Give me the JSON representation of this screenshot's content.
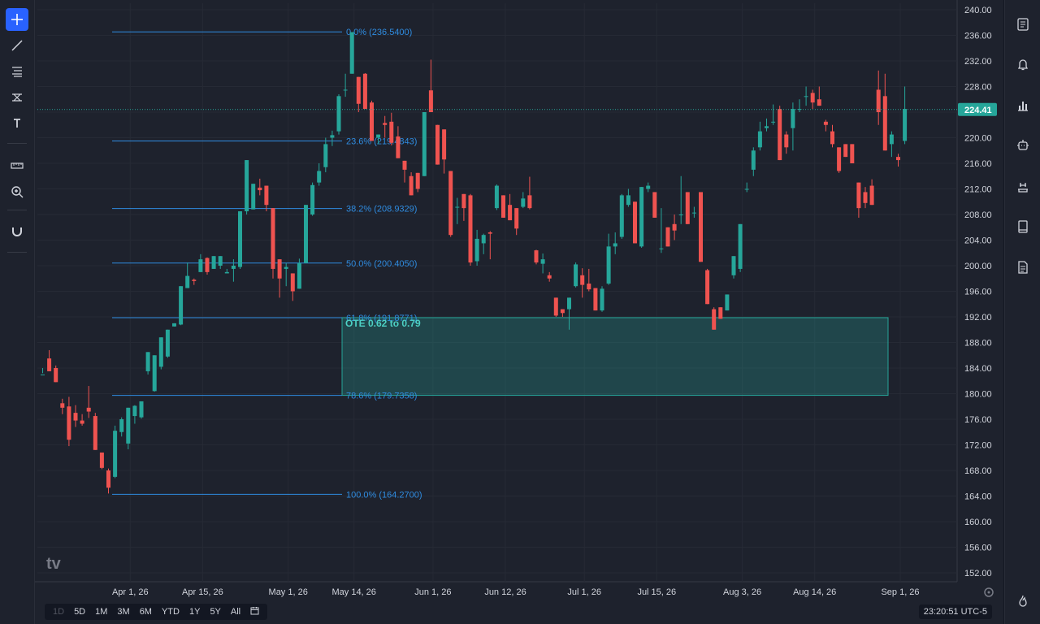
{
  "toolbar": {
    "tools": [
      {
        "name": "crosshair-tool",
        "icon": "crosshair-icon",
        "active": true
      },
      {
        "name": "trend-line-tool",
        "icon": "trend-line-icon"
      },
      {
        "name": "fib-retracement-tool",
        "icon": "fib-retracement-icon"
      },
      {
        "name": "patterns-tool",
        "icon": "patterns-icon"
      },
      {
        "name": "text-tool",
        "icon": "text-icon",
        "label": "T"
      },
      {
        "name": "ruler-tool",
        "icon": "ruler-icon"
      },
      {
        "name": "zoom-tool",
        "icon": "zoom-in-icon"
      },
      {
        "name": "magnet-tool",
        "icon": "magnet-icon"
      }
    ]
  },
  "right_panel": {
    "tools": [
      {
        "name": "watchlist-button",
        "icon": "document-list-icon"
      },
      {
        "name": "alerts-button",
        "icon": "bell-icon"
      },
      {
        "name": "data-window-button",
        "icon": "bar-chart-icon"
      },
      {
        "name": "hotlist-button",
        "icon": "robot-icon"
      },
      {
        "name": "calendar-button",
        "icon": "calendar-icon"
      },
      {
        "name": "notes-button",
        "icon": "book-icon"
      },
      {
        "name": "news-button",
        "icon": "news-icon"
      },
      {
        "name": "help-button",
        "icon": "flame-icon"
      }
    ]
  },
  "chart_data": {
    "type": "candlestick",
    "y_ticks": [
      "240.00",
      "236.00",
      "232.00",
      "228.00",
      "224.00",
      "220.00",
      "216.00",
      "212.00",
      "208.00",
      "204.00",
      "200.00",
      "196.00",
      "192.00",
      "188.00",
      "184.00",
      "180.00",
      "176.00",
      "172.00",
      "168.00",
      "164.00",
      "160.00",
      "156.00",
      "152.00"
    ],
    "y_range": [
      150.5,
      241.5
    ],
    "x_ticks": [
      "Apr 1, 26",
      "Apr 15, 26",
      "May 1, 26",
      "May 14, 26",
      "Jun 1, 26",
      "Jun 12, 26",
      "Jul 1, 26",
      "Jul 15, 26",
      "Aug 3, 26",
      "Aug 14, 26",
      "Sep 1, 26"
    ],
    "last_price": "224.41",
    "colors": {
      "up": "#26a69a",
      "down": "#ef5350",
      "fib": "#2f8ce0",
      "ote_fill": "#26a69a",
      "background": "#1e222d",
      "grid": "#2a2e39"
    },
    "fibonacci": {
      "levels": [
        {
          "label": "0.0% (236.5400)",
          "price": 236.54
        },
        {
          "label": "23.6% (219.4843)",
          "price": 219.4843
        },
        {
          "label": "38.2% (208.9329)",
          "price": 208.9329
        },
        {
          "label": "50.0% (200.4050)",
          "price": 200.405
        },
        {
          "label": "61.8% (191.8771)",
          "price": 191.8771
        },
        {
          "label": "78.6% (179.7358)",
          "price": 179.7358
        },
        {
          "label": "100.0% (164.2700)",
          "price": 164.27
        }
      ]
    },
    "ote_zone": {
      "label": "OTE 0.62 to 0.79",
      "top": 191.8771,
      "bottom": 179.7358
    },
    "candles": [
      [
        183.0,
        183.2,
        184.0,
        183.0
      ],
      [
        185.5,
        186.8,
        183.5,
        183.5
      ],
      [
        184.0,
        184.4,
        181.8,
        181.8
      ],
      [
        178.5,
        179.2,
        176.8,
        177.8
      ],
      [
        178.0,
        179.5,
        171.8,
        172.8
      ],
      [
        177.0,
        178.2,
        174.8,
        175.8
      ],
      [
        175.8,
        176.8,
        175.0,
        175.3
      ],
      [
        177.8,
        181.2,
        176.2,
        177.2
      ],
      [
        176.5,
        177.0,
        171.2,
        171.2
      ],
      [
        170.8,
        170.8,
        168.2,
        168.4
      ],
      [
        168.0,
        168.3,
        164.4,
        165.3
      ],
      [
        167.0,
        175.0,
        166.8,
        174.2
      ],
      [
        174.0,
        176.3,
        173.3,
        176.0
      ],
      [
        172.2,
        177.8,
        171.3,
        177.8
      ],
      [
        176.5,
        178.2,
        175.3,
        178.1
      ],
      [
        176.3,
        178.8,
        176.1,
        178.8
      ],
      [
        183.5,
        186.5,
        183.0,
        186.5
      ],
      [
        180.4,
        186.0,
        180.3,
        186.0
      ],
      [
        184.2,
        188.8,
        183.8,
        188.8
      ],
      [
        185.8,
        190.0,
        185.6,
        190.0
      ],
      [
        190.5,
        191.0,
        190.5,
        191.0
      ],
      [
        190.8,
        196.8,
        190.7,
        196.8
      ],
      [
        196.5,
        200.5,
        196.5,
        198.4
      ],
      [
        197.8,
        198.0,
        197.0,
        197.6
      ],
      [
        199.0,
        201.8,
        199.0,
        201.0
      ],
      [
        201.2,
        201.3,
        198.6,
        199.0
      ],
      [
        199.5,
        201.5,
        199.5,
        201.5
      ],
      [
        200.0,
        201.5,
        199.5,
        201.5
      ],
      [
        198.8,
        199.5,
        198.8,
        199.0
      ],
      [
        199.5,
        201.0,
        197.5,
        200.0
      ],
      [
        199.8,
        208.5,
        199.5,
        208.5
      ],
      [
        208.5,
        216.5,
        208.0,
        216.5
      ],
      [
        208.8,
        212.8,
        208.8,
        212.8
      ],
      [
        212.2,
        213.6,
        211.0,
        211.8
      ],
      [
        212.5,
        212.5,
        208.5,
        209.5
      ],
      [
        209.0,
        209.0,
        198.0,
        199.5
      ],
      [
        201.0,
        201.0,
        195.0,
        198.0
      ],
      [
        199.5,
        200.4,
        196.8,
        199.8
      ],
      [
        198.8,
        198.8,
        194.5,
        196.0
      ],
      [
        196.4,
        201.1,
        196.4,
        200.4
      ],
      [
        200.4,
        209.5,
        200.4,
        209.5
      ],
      [
        208.0,
        213.0,
        207.8,
        212.6
      ],
      [
        213.0,
        216.0,
        212.5,
        214.8
      ],
      [
        215.4,
        220.0,
        214.6,
        219.0
      ],
      [
        220.0,
        221.1,
        218.7,
        220.4
      ],
      [
        221.0,
        226.8,
        220.5,
        226.5
      ],
      [
        227.5,
        230.0,
        226.4,
        227.5
      ],
      [
        230.0,
        236.5,
        230.0,
        236.5
      ],
      [
        229.5,
        229.5,
        224.0,
        225.3
      ],
      [
        230.0,
        230.1,
        224.5,
        224.5
      ],
      [
        225.5,
        225.8,
        219.5,
        219.5
      ],
      [
        220.0,
        220.5,
        219.0,
        220.5
      ],
      [
        222.3,
        223.4,
        220.0,
        222.0
      ],
      [
        222.5,
        223.9,
        218.8,
        219.2
      ],
      [
        220.2,
        221.8,
        216.8,
        216.8
      ],
      [
        216.4,
        216.4,
        213.0,
        215.0
      ],
      [
        214.0,
        214.6,
        211.0,
        211.0
      ],
      [
        214.5,
        214.5,
        211.5,
        212.0
      ],
      [
        214.0,
        224.0,
        214.0,
        224.0
      ],
      [
        227.4,
        232.2,
        224.0,
        224.0
      ],
      [
        222.0,
        222.0,
        215.8,
        215.8
      ],
      [
        221.3,
        221.3,
        214.4,
        216.6
      ],
      [
        214.8,
        214.8,
        204.5,
        204.8
      ],
      [
        209.2,
        210.6,
        206.5,
        209.2
      ],
      [
        211.2,
        211.2,
        207.0,
        209.0
      ],
      [
        211.0,
        211.2,
        200.0,
        200.5
      ],
      [
        200.7,
        205.6,
        200.0,
        204.2
      ],
      [
        203.5,
        205.0,
        201.8,
        204.8
      ],
      [
        205.2,
        205.4,
        201.0,
        205.0
      ],
      [
        209.0,
        212.7,
        208.7,
        212.5
      ],
      [
        211.0,
        211.0,
        207.5,
        207.5
      ],
      [
        209.5,
        211.2,
        207.1,
        207.1
      ],
      [
        209.0,
        209.0,
        204.8,
        205.8
      ],
      [
        209.2,
        211.5,
        209.0,
        210.5
      ],
      [
        211.0,
        213.9,
        208.8,
        209.0
      ],
      [
        202.4,
        202.5,
        200.2,
        200.5
      ],
      [
        200.3,
        201.9,
        198.8,
        201.0
      ],
      [
        198.5,
        199.0,
        197.5,
        198.0
      ],
      [
        195.0,
        195.0,
        192.0,
        192.2
      ],
      [
        193.2,
        193.2,
        192.0,
        192.6
      ],
      [
        193.2,
        195.0,
        190.0,
        195.0
      ],
      [
        196.8,
        200.5,
        196.6,
        200.2
      ],
      [
        198.5,
        199.6,
        195.0,
        197.0
      ],
      [
        197.2,
        199.5,
        196.0,
        196.3
      ],
      [
        196.5,
        196.5,
        193.0,
        193.0
      ],
      [
        193.0,
        196.8,
        192.8,
        196.4
      ],
      [
        197.2,
        205.0,
        197.0,
        203.0
      ],
      [
        203.0,
        205.2,
        201.8,
        203.5
      ],
      [
        204.5,
        211.2,
        204.2,
        211.0
      ],
      [
        209.5,
        212.0,
        209.2,
        211.0
      ],
      [
        210.0,
        210.0,
        203.5,
        203.5
      ],
      [
        203.0,
        212.3,
        202.8,
        212.3
      ],
      [
        212.0,
        213.0,
        211.5,
        212.5
      ],
      [
        211.5,
        211.5,
        207.5,
        207.5
      ],
      [
        202.7,
        209.0,
        202.0,
        202.7
      ],
      [
        206.0,
        206.0,
        203.0,
        203.0
      ],
      [
        206.5,
        208.0,
        204.0,
        205.5
      ],
      [
        208.0,
        214.0,
        206.5,
        208.0
      ],
      [
        211.5,
        211.5,
        206.5,
        206.5
      ],
      [
        208.3,
        209.2,
        207.5,
        208.3
      ],
      [
        211.5,
        211.5,
        200.6,
        200.6
      ],
      [
        199.3,
        199.5,
        194.0,
        194.0
      ],
      [
        193.2,
        193.5,
        190.0,
        190.0
      ],
      [
        193.5,
        193.5,
        191.7,
        191.7
      ],
      [
        193.0,
        195.5,
        193.0,
        195.5
      ],
      [
        198.5,
        201.5,
        198.0,
        201.5
      ],
      [
        199.5,
        206.5,
        199.0,
        206.5
      ],
      [
        212.0,
        213.0,
        211.5,
        212.0
      ],
      [
        215.0,
        218.5,
        214.0,
        218.0
      ],
      [
        218.5,
        222.5,
        218.0,
        221.0
      ],
      [
        221.5,
        223.0,
        221.0,
        221.8
      ],
      [
        222.5,
        225.2,
        222.0,
        222.5
      ],
      [
        224.5,
        225.0,
        216.5,
        216.5
      ],
      [
        220.5,
        221.0,
        217.5,
        218.5
      ],
      [
        221.5,
        225.5,
        218.0,
        224.5
      ],
      [
        224.5,
        226.0,
        224.0,
        224.5
      ],
      [
        226.5,
        228.0,
        225.0,
        226.5
      ],
      [
        227.0,
        227.5,
        224.5,
        225.5
      ],
      [
        226.0,
        228.0,
        225.0,
        225.0
      ],
      [
        222.5,
        222.8,
        221.0,
        222.0
      ],
      [
        221.0,
        222.0,
        218.5,
        219.0
      ],
      [
        218.5,
        218.5,
        214.5,
        214.8
      ],
      [
        219.0,
        219.0,
        217.0,
        217.0
      ],
      [
        219.0,
        219.0,
        216.0,
        216.0
      ],
      [
        213.0,
        213.0,
        207.5,
        209.0
      ],
      [
        211.5,
        212.3,
        209.0,
        209.8
      ],
      [
        212.5,
        213.5,
        209.5,
        209.5
      ],
      [
        227.5,
        230.5,
        222.0,
        224.0
      ],
      [
        226.5,
        230.0,
        218.0,
        218.0
      ],
      [
        219.0,
        221.0,
        217.0,
        220.5
      ],
      [
        217.0,
        217.5,
        215.5,
        216.5
      ],
      [
        219.5,
        228.0,
        219.0,
        224.5
      ]
    ]
  },
  "bottom_bar": {
    "ranges": [
      {
        "label": "1D",
        "disabled": true
      },
      {
        "label": "5D"
      },
      {
        "label": "1M"
      },
      {
        "label": "3M"
      },
      {
        "label": "6M"
      },
      {
        "label": "YTD"
      },
      {
        "label": "1Y"
      },
      {
        "label": "5Y"
      },
      {
        "label": "All"
      }
    ],
    "clock": "23:20:51 UTC-5"
  }
}
